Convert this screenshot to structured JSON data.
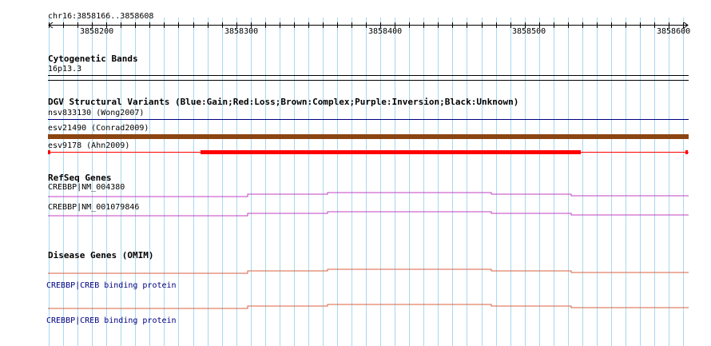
{
  "ruler": {
    "region": "chr16:3858166..3858608",
    "ticks": [
      "3858200",
      "3858300",
      "3858400",
      "3858500",
      "3858600"
    ]
  },
  "cytoband": {
    "title": "Cytogenetic Bands",
    "band": "16p13.3"
  },
  "dgv": {
    "title": "DGV Structural Variants (Blue:Gain;Red:Loss;Brown:Complex;Purple:Inversion;Black:Unknown)",
    "variants": [
      {
        "label": "nsv833130 (Wong2007)",
        "type": "Gain",
        "color": "#000080"
      },
      {
        "label": "esv21490 (Conrad2009)",
        "type": "Complex",
        "color": "#8b4513"
      },
      {
        "label": "esv9178 (Ahn2009)",
        "type": "Loss",
        "color": "#ff0000"
      }
    ]
  },
  "refseq": {
    "title": "RefSeq Genes",
    "genes": [
      {
        "label": "CREBBP|NM_004380",
        "color": "#c040c0"
      },
      {
        "label": "CREBBP|NM_001079846",
        "color": "#c040c0"
      }
    ]
  },
  "omim": {
    "title": "Disease Genes (OMIM)",
    "genes": [
      {
        "label": "CREBBP|CREB binding protein",
        "color": "#d96040"
      },
      {
        "label": "CREBBP|CREB binding protein",
        "color": "#d96040"
      }
    ]
  }
}
